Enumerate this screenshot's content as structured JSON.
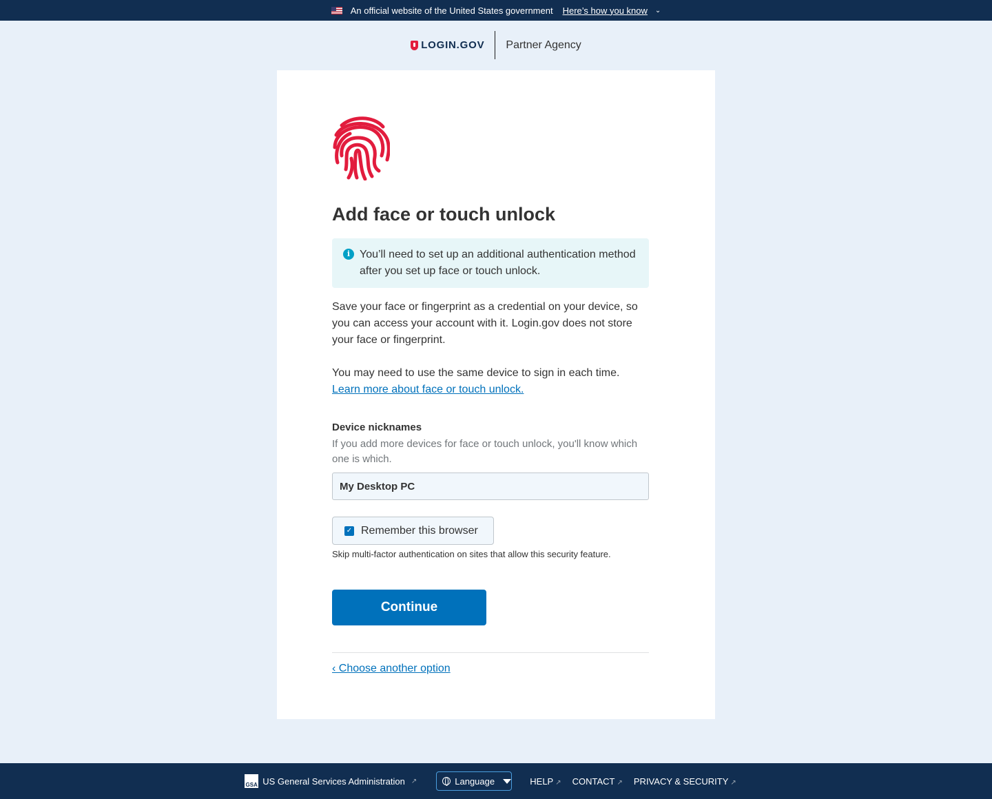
{
  "gov_banner": {
    "text": "An official website of the United States government",
    "link": "Here’s how you know"
  },
  "header": {
    "logo": "LOGIN.GOV",
    "partner": "Partner Agency"
  },
  "page": {
    "title": "Add face or touch unlock",
    "alert": "You’ll need to set up an additional authentication method after you set up face or touch unlock.",
    "intro": "Save your face or fingerprint as a credential on your device, so you can access your account with it. Login.gov does not store your face or fingerprint.",
    "device_note": "You may need to use the same device to sign in each time.",
    "learn_more": "Learn more about face or touch unlock.",
    "nickname_label": "Device nicknames",
    "nickname_hint": "If you add more devices for face or touch unlock, you'll know which one is which.",
    "nickname_value": "My Desktop PC",
    "remember_label": "Remember this browser",
    "remember_checked": true,
    "skip_note": "Skip multi-factor authentication on sites that allow this security feature.",
    "continue_label": "Continue",
    "back_label": "‹ Choose another option"
  },
  "footer": {
    "gsa": "US General Services Administration",
    "gsa_logo": "GSA",
    "language": "Language",
    "help": "HELP",
    "contact": "CONTACT",
    "privacy": "PRIVACY & SECURITY"
  },
  "colors": {
    "primary": "#0071bb",
    "brand_red": "#e21c3d",
    "navy": "#112e51"
  }
}
